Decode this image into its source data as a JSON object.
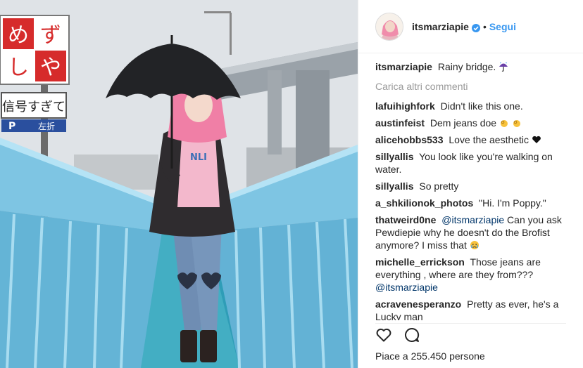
{
  "post": {
    "username": "itsmarziapie",
    "separator": "•",
    "follow_label": "Segui",
    "caption_user": "itsmarziapie",
    "caption_text": "Rainy bridge.",
    "load_more": "Carica altri commenti",
    "likes": "Piace a 255.450 persone"
  },
  "photo": {
    "sign_top_chars": [
      "め",
      "ず",
      "し",
      "や"
    ],
    "sign_mid_text": "信号すぎて",
    "sign_p": "P",
    "sign_p_text": "左折",
    "shirt_text": "NLI"
  },
  "comments": [
    {
      "user": "lafuihighfork",
      "text": "Didn't like this one."
    },
    {
      "user": "austinfeist",
      "text": "Dem jeans doe",
      "emoji": "ok-hand-icon"
    },
    {
      "user": "alicehobbs533",
      "text": "Love the aesthetic",
      "emoji": "black-heart-icon"
    },
    {
      "user": "sillyallis",
      "text": "You look like you're walking on water."
    },
    {
      "user": "sillyallis",
      "text": "So pretty"
    },
    {
      "user": "a_shkilionok_photos",
      "text": "\"Hi. I'm Poppy.\""
    },
    {
      "user": "thatweird0ne",
      "mention": "@itsmarziapie",
      "text": "Can you ask Pewdiepie why he doesn't do the Brofist anymore? I miss that",
      "emoji": "crying-face-icon"
    },
    {
      "user": "michelle_errickson",
      "text": "Those jeans are everything , where are they from???",
      "mention_after": "@itsmarziapie"
    },
    {
      "user": "acravenesperanzo",
      "text": "Pretty as ever, he's a Lucky man"
    }
  ],
  "icons": {
    "verified": "verified-badge-icon",
    "like": "heart-outline-icon",
    "comment": "comment-bubble-icon",
    "caption_emoji": "umbrella-rain-icon"
  },
  "colors": {
    "accent": "#3897f0",
    "mention": "#003569",
    "muted": "#999999",
    "text": "#262626"
  }
}
